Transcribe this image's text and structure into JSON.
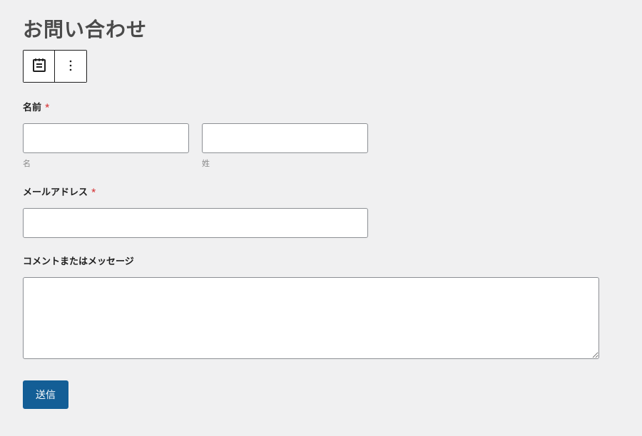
{
  "page": {
    "title": "お問い合わせ"
  },
  "toolbar": {
    "form_icon": "form-icon",
    "more_icon": "more-vertical-icon"
  },
  "fields": {
    "name": {
      "label": "名前",
      "required": "*",
      "first_sublabel": "名",
      "last_sublabel": "姓"
    },
    "email": {
      "label": "メールアドレス",
      "required": "*"
    },
    "message": {
      "label": "コメントまたはメッセージ"
    }
  },
  "submit": {
    "label": "送信"
  }
}
